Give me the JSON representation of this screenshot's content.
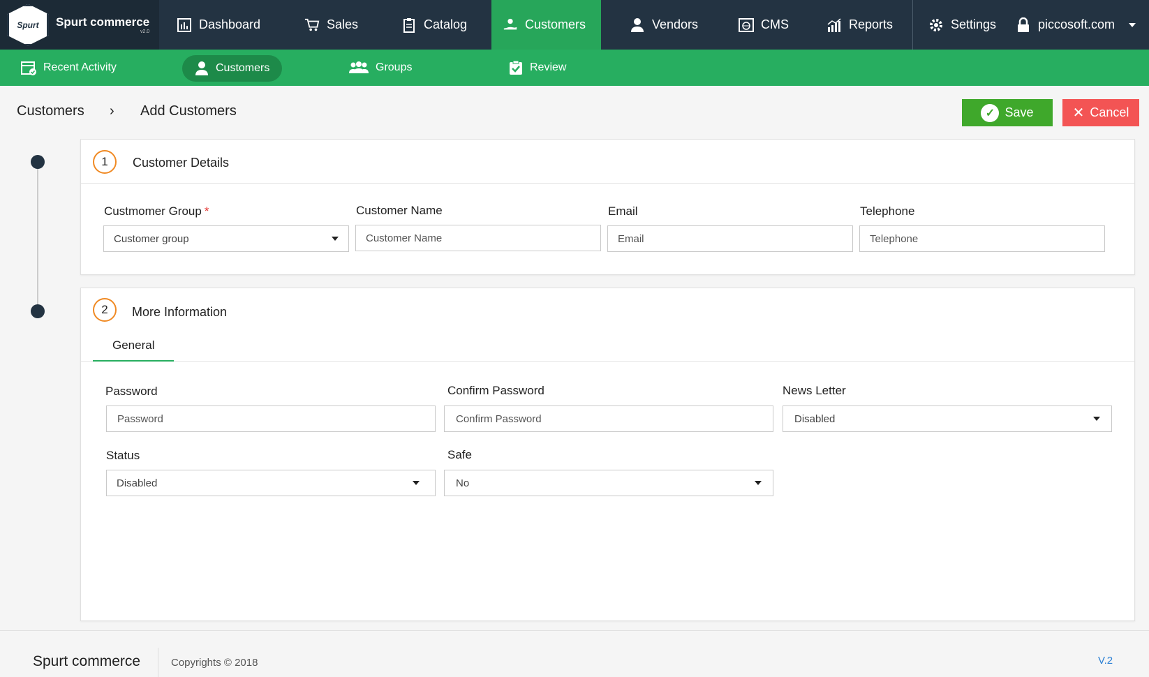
{
  "brand": {
    "logo_badge_text": "Spurt",
    "name": "Spurt commerce",
    "version": "v2.0"
  },
  "topnav": {
    "items": [
      {
        "label": "Dashboard",
        "icon": "dashboard-icon"
      },
      {
        "label": "Sales",
        "icon": "cart-icon"
      },
      {
        "label": "Catalog",
        "icon": "clipboard-icon"
      },
      {
        "label": "Customers",
        "icon": "customers-hand-icon",
        "active": true
      },
      {
        "label": "Vendors",
        "icon": "vendor-user-icon"
      },
      {
        "label": "CMS",
        "icon": "cms-globe-icon"
      },
      {
        "label": "Reports",
        "icon": "reports-chart-icon"
      }
    ],
    "settings_label": "Settings",
    "account_label": "piccosoft.com"
  },
  "subnav": {
    "items": [
      {
        "label": "Recent Activity",
        "icon": "calendar-check-icon"
      },
      {
        "label": "Customers",
        "icon": "user-icon",
        "active": true
      },
      {
        "label": "Groups",
        "icon": "group-users-icon"
      },
      {
        "label": "Review",
        "icon": "review-check-icon"
      }
    ]
  },
  "breadcrumb": {
    "parent": "Customers",
    "separator": "›",
    "current": "Add Customers"
  },
  "actions": {
    "save_label": "Save",
    "cancel_label": "Cancel"
  },
  "section1": {
    "step": "1",
    "title": "Customer Details",
    "fields": {
      "group_label": "Custmomer Group",
      "group_required": "*",
      "group_value": "Customer group",
      "name_label": "Customer Name",
      "name_placeholder": "Customer Name",
      "email_label": "Email",
      "email_placeholder": "Email",
      "phone_label": "Telephone",
      "phone_placeholder": "Telephone"
    }
  },
  "section2": {
    "step": "2",
    "title": "More Information",
    "tab": "General",
    "fields": {
      "password_label": "Password",
      "password_placeholder": "Password",
      "confirm_label": "Confirm Password",
      "confirm_placeholder": "Confirm Password",
      "newsletter_label": "News Letter",
      "newsletter_value": "Disabled",
      "status_label": "Status",
      "status_value": "Disabled",
      "safe_label": "Safe",
      "safe_value": "No"
    }
  },
  "footer": {
    "brand": "Spurt commerce",
    "copyright": "Copyrights © 2018",
    "version": "V.2"
  },
  "colors": {
    "topbar": "#233342",
    "active_green": "#27a65a",
    "subbar": "#27ae60",
    "save": "#3fa82b",
    "cancel": "#f35454",
    "step_ring": "#f08a24",
    "version_link": "#2a7fd4"
  }
}
